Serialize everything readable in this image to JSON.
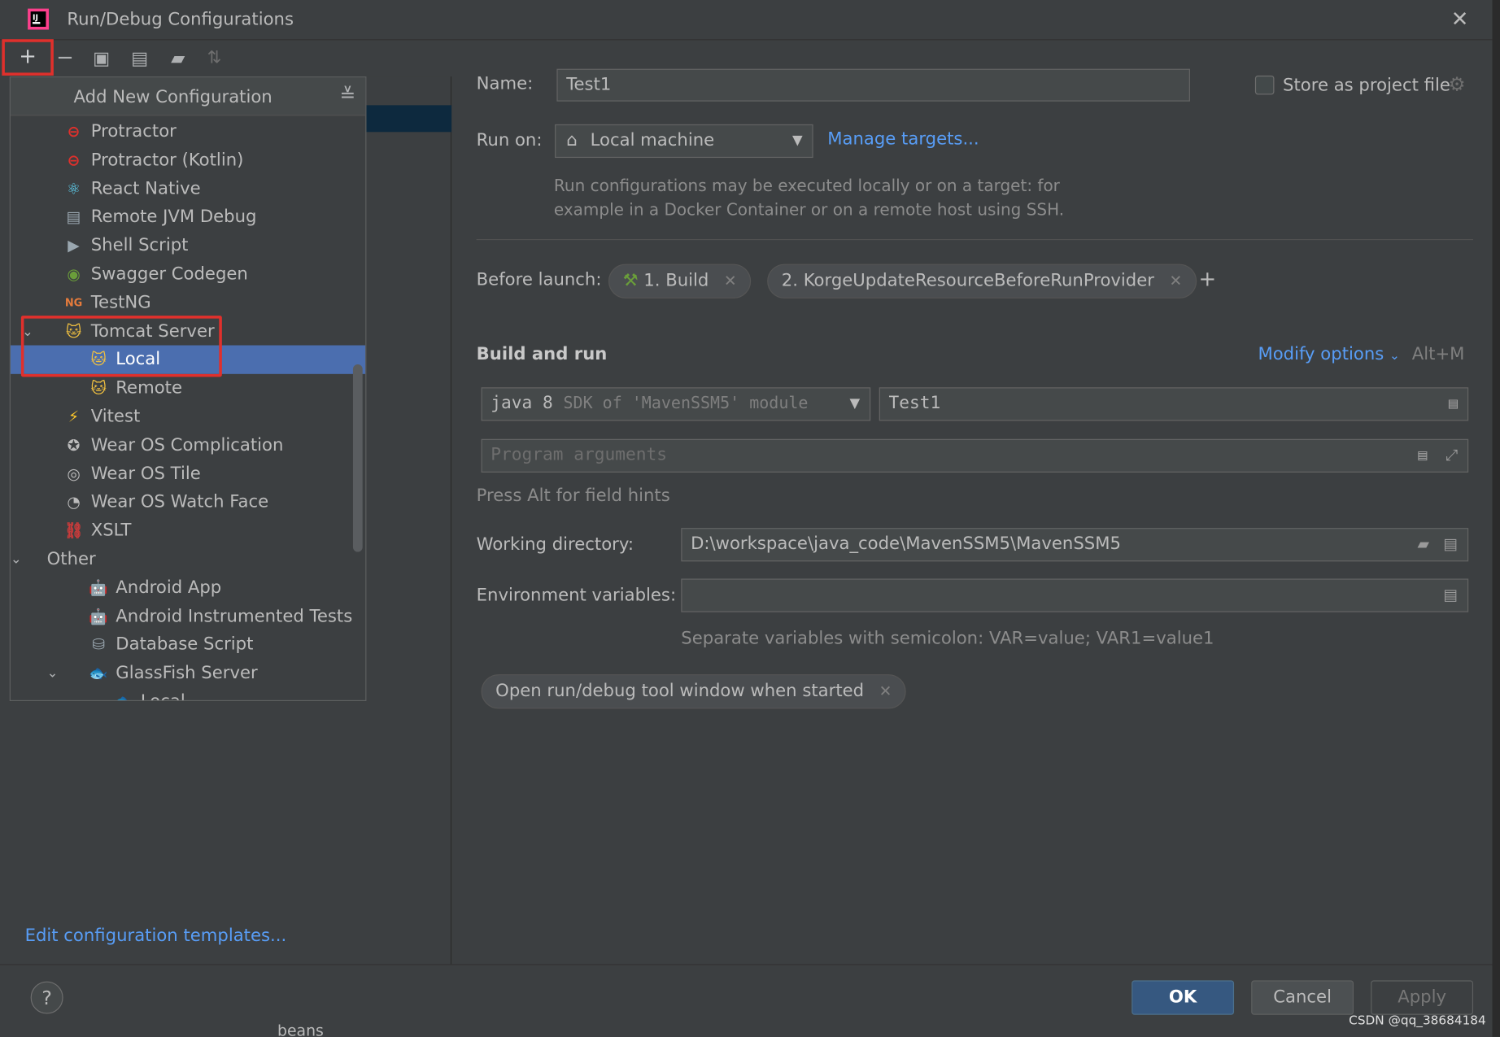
{
  "window": {
    "title": "Run/Debug Configurations",
    "close_glyph": "✕"
  },
  "toolbar": {
    "add": "+",
    "remove": "−",
    "copy": "⧉",
    "save": "💾",
    "folder": "📁",
    "sort": "↓ª"
  },
  "popup": {
    "title": "Add New Configuration",
    "items": [
      {
        "label": "Protractor",
        "icon": "protractor-icon",
        "glyph": "⊖",
        "color": "#e0302c",
        "indent": 1
      },
      {
        "label": "Protractor (Kotlin)",
        "icon": "protractor-icon",
        "glyph": "⊖",
        "color": "#e0302c",
        "indent": 1
      },
      {
        "label": "React Native",
        "icon": "react-icon",
        "glyph": "⚛",
        "color": "#61dafb",
        "indent": 1
      },
      {
        "label": "Remote JVM Debug",
        "icon": "remote-debug-icon",
        "glyph": "▤",
        "color": "#9aa7b0",
        "indent": 1
      },
      {
        "label": "Shell Script",
        "icon": "shell-icon",
        "glyph": "▶",
        "color": "#9aa7b0",
        "indent": 1
      },
      {
        "label": "Swagger Codegen",
        "icon": "swagger-icon",
        "glyph": "◉",
        "color": "#6a9e3a",
        "indent": 1
      },
      {
        "label": "TestNG",
        "icon": "testng-icon",
        "glyph": "NG",
        "color": "#e57b3c",
        "indent": 1
      },
      {
        "label": "Tomcat Server",
        "icon": "tomcat-icon",
        "glyph": "🐱",
        "color": "#f0c040",
        "indent": 1,
        "expanded": true
      },
      {
        "label": "Local",
        "icon": "tomcat-icon",
        "glyph": "🐱",
        "color": "#f0c040",
        "indent": 2,
        "selected": true
      },
      {
        "label": "Remote",
        "icon": "tomcat-icon",
        "glyph": "🐱",
        "color": "#f0c040",
        "indent": 2
      },
      {
        "label": "Vitest",
        "icon": "vitest-icon",
        "glyph": "⚡",
        "color": "#fcc72b",
        "indent": 1
      },
      {
        "label": "Wear OS Complication",
        "icon": "wear-os-icon",
        "glyph": "✪",
        "color": "#bbbbbb",
        "indent": 1
      },
      {
        "label": "Wear OS Tile",
        "icon": "wear-os-icon",
        "glyph": "◎",
        "color": "#bbbbbb",
        "indent": 1
      },
      {
        "label": "Wear OS Watch Face",
        "icon": "watch-icon",
        "glyph": "◔",
        "color": "#bbbbbb",
        "indent": 1
      },
      {
        "label": "XSLT",
        "icon": "xslt-icon",
        "glyph": "⛓",
        "color": "#c93b3b",
        "indent": 1
      },
      {
        "label": "Other",
        "icon": "",
        "glyph": "",
        "color": "#bbbbbb",
        "indent": 0,
        "expanded": true
      },
      {
        "label": "Android App",
        "icon": "android-icon",
        "glyph": "🤖",
        "color": "#3ddc84",
        "indent": 2
      },
      {
        "label": "Android Instrumented Tests",
        "icon": "android-test-icon",
        "glyph": "🤖",
        "color": "#3ddc84",
        "indent": 2
      },
      {
        "label": "Database Script",
        "icon": "database-icon",
        "glyph": "⛁",
        "color": "#9aa7b0",
        "indent": 2
      },
      {
        "label": "GlassFish Server",
        "icon": "glassfish-icon",
        "glyph": "🐟",
        "color": "#bbbbbb",
        "indent": 2,
        "expanded": true
      },
      {
        "label": "Local",
        "icon": "glassfish-icon",
        "glyph": "🐟",
        "color": "#bbbbbb",
        "indent": 3
      }
    ]
  },
  "left": {
    "edit_templates": "Edit configuration templates...",
    "help": "?"
  },
  "form": {
    "name_label": "Name:",
    "name_value": "Test1",
    "store_label": "Store as project file",
    "run_on_label": "Run on:",
    "run_on_value": "Local machine",
    "manage_targets": "Manage targets...",
    "run_on_hint_1": "Run configurations may be executed locally or on a target: for",
    "run_on_hint_2": "example in a Docker Container or on a remote host using SSH.",
    "before_launch_label": "Before launch:",
    "before_launch_1": "1. Build",
    "before_launch_2": "2. KorgeUpdateResourceBeforeRunProvider",
    "add_task": "+",
    "build_run_title": "Build and run",
    "modify_options": "Modify options",
    "modify_shortcut": "Alt+M",
    "sdk_java": "java 8",
    "sdk_detail": "SDK of 'MavenSSM5' module",
    "main_class": "Test1",
    "program_args_placeholder": "Program arguments",
    "alt_hint": "Press Alt for field hints",
    "working_dir_label": "Working directory:",
    "working_dir_value": "D:\\workspace\\java_code\\MavenSSM5\\MavenSSM5",
    "env_label": "Environment variables:",
    "env_value": "",
    "env_hint": "Separate variables with semicolon: VAR=value; VAR1=value1",
    "open_tool_window": "Open run/debug tool window when started"
  },
  "buttons": {
    "ok": "OK",
    "cancel": "Cancel",
    "apply": "Apply"
  },
  "background": {
    "beans": "beans",
    "watermark": "CSDN @qq_38684184"
  },
  "colors": {
    "accent": "#4b6eaf",
    "link": "#589df6",
    "highlight": "#e0302c",
    "ok_button": "#365880"
  }
}
